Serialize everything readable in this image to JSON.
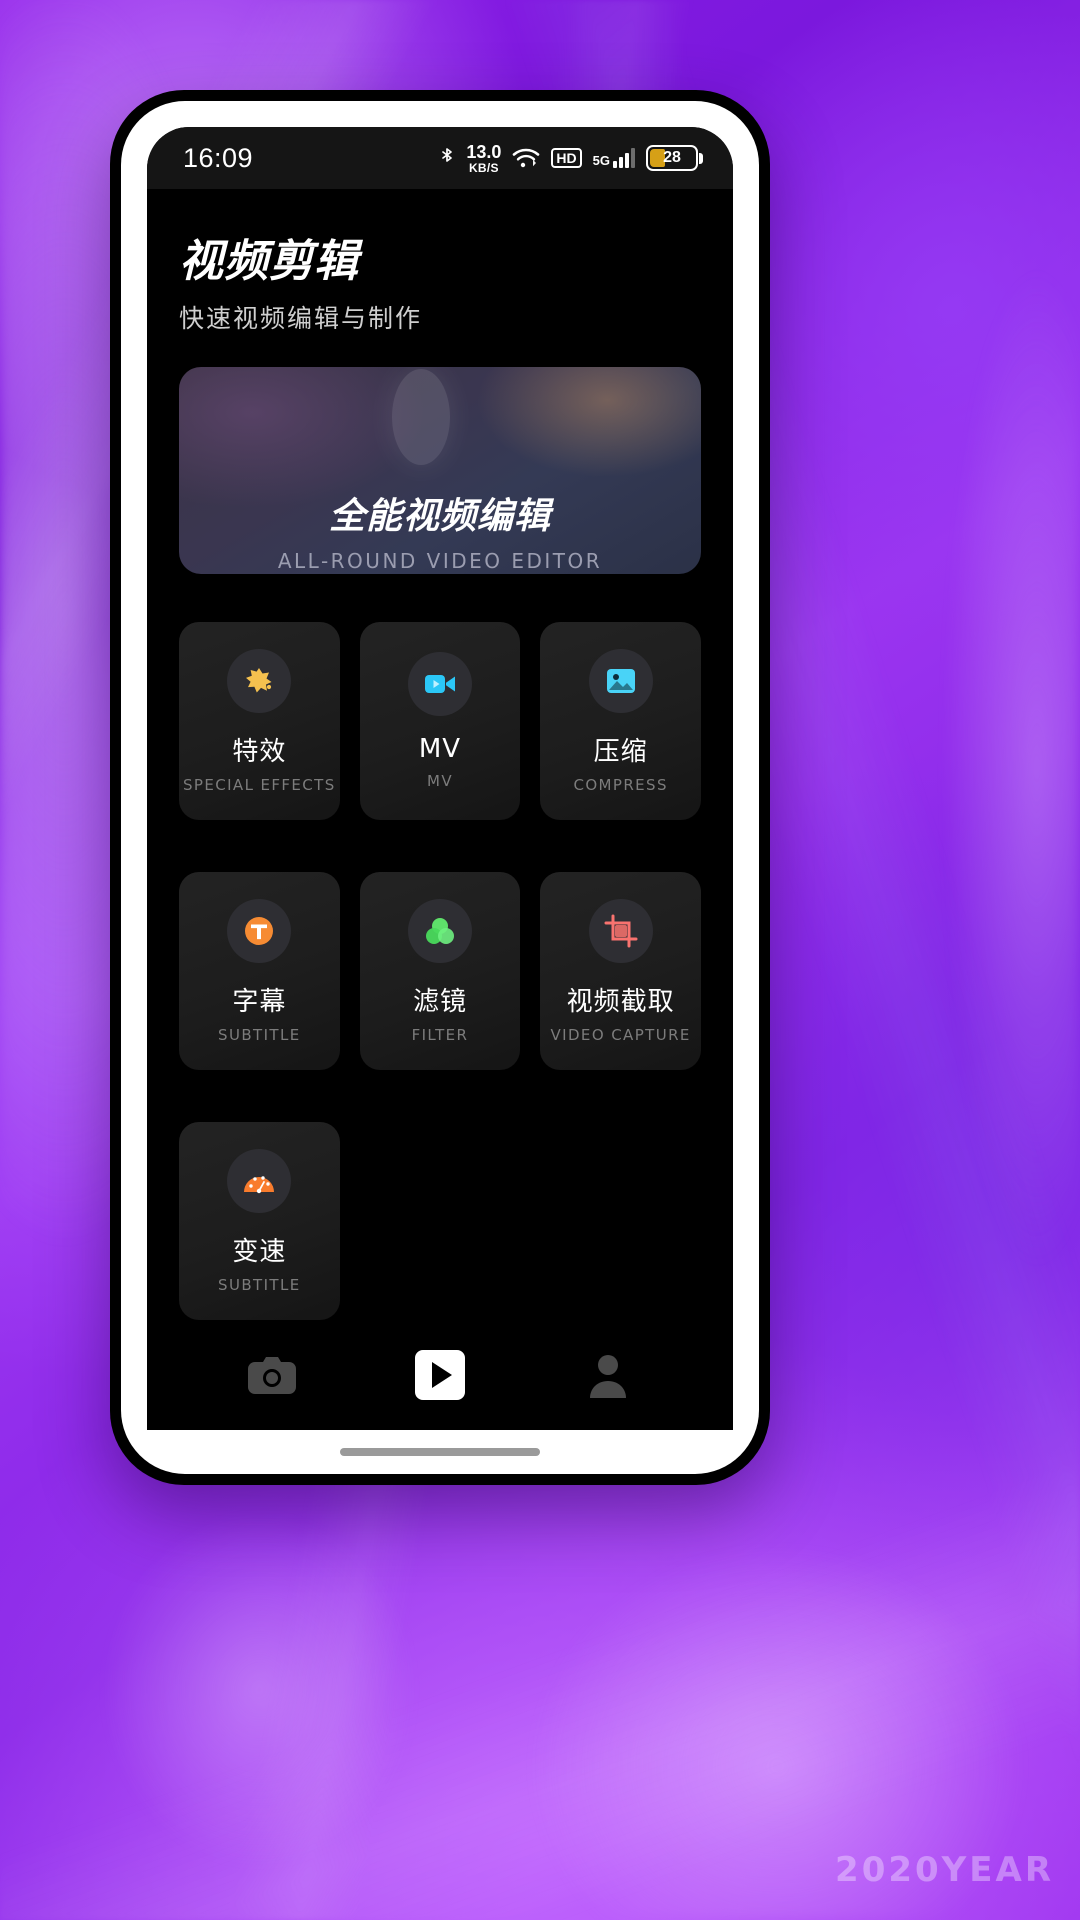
{
  "statusbar": {
    "clock": "16:09",
    "bluetooth_icon": "bluetooth-icon",
    "net_speed_value": "13.0",
    "net_speed_unit": "KB/S",
    "wifi_icon": "wifi-icon",
    "hd_label": "HD",
    "network_label": "5G",
    "battery_percent": "28"
  },
  "header": {
    "title": "视频剪辑",
    "subtitle": "快速视频编辑与制作"
  },
  "banner": {
    "title": "全能视频编辑",
    "subtitle": "ALL-ROUND VIDEO EDITOR",
    "plus_icon": "plus-icon"
  },
  "features": [
    {
      "label": "特效",
      "sub": "SPECIAL EFFECTS",
      "icon": "sparkle-splash-icon",
      "color": "#f5c14f"
    },
    {
      "label": "MV",
      "sub": "MV",
      "icon": "video-camera-icon",
      "color": "#29c5f6"
    },
    {
      "label": "压缩",
      "sub": "COMPRESS",
      "icon": "image-icon",
      "color": "#49d3f7"
    },
    {
      "label": "字幕",
      "sub": "SUBTITLE",
      "icon": "text-t-icon",
      "color": "#f68b33"
    },
    {
      "label": "滤镜",
      "sub": "FILTER",
      "icon": "three-circles-icon",
      "color": "#5ee06a"
    },
    {
      "label": "视频截取",
      "sub": "VIDEO CAPTURE",
      "icon": "crop-icon",
      "color": "#f9736f"
    },
    {
      "label": "变速",
      "sub": "SUBTITLE",
      "icon": "speedometer-icon",
      "color": "#f97c2d"
    }
  ],
  "bottom_nav": [
    {
      "name": "camera-tab",
      "icon": "camera-icon"
    },
    {
      "name": "play-tab",
      "icon": "play-icon"
    },
    {
      "name": "profile-tab",
      "icon": "person-icon"
    }
  ],
  "watermark": "2020YEAR"
}
